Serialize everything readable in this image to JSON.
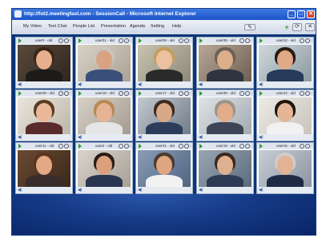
{
  "window": {
    "title": "http://fot2.meetingfast.com - SessionCall - Microsoft Internet Explorer",
    "minimize_glyph": "_",
    "maximize_glyph": "□",
    "close_glyph": "✕"
  },
  "menu": {
    "items": [
      "My Video",
      "Text Chat",
      "People List",
      "Presentation",
      "Agenda",
      "Setting",
      "Help"
    ]
  },
  "toolbar": {
    "edit_glyph": "✎",
    "plus_glyph": "+",
    "refresh_glyph": "⟳",
    "close_glyph": "✕"
  },
  "tiles": [
    {
      "name": "user0 - old"
    },
    {
      "name": "user01 - old"
    },
    {
      "name": "user09 - old"
    },
    {
      "name": "user06 - old"
    },
    {
      "name": "user10 - old"
    },
    {
      "name": "user09 - old"
    },
    {
      "name": "user18 - old"
    },
    {
      "name": "user17 - old"
    },
    {
      "name": "user09 - old"
    },
    {
      "name": "user24 - old"
    },
    {
      "name": "user11 - old"
    },
    {
      "name": "user2 - old"
    },
    {
      "name": "user21 - old"
    },
    {
      "name": "user19 - old"
    },
    {
      "name": "user15 - old"
    }
  ],
  "tile_icons": {
    "speaker": "◀)",
    "close": "◌"
  },
  "colors": {
    "titlebar": "#1d54c8",
    "panel": "#0b3478",
    "tile_header": "#dfe6ef"
  }
}
